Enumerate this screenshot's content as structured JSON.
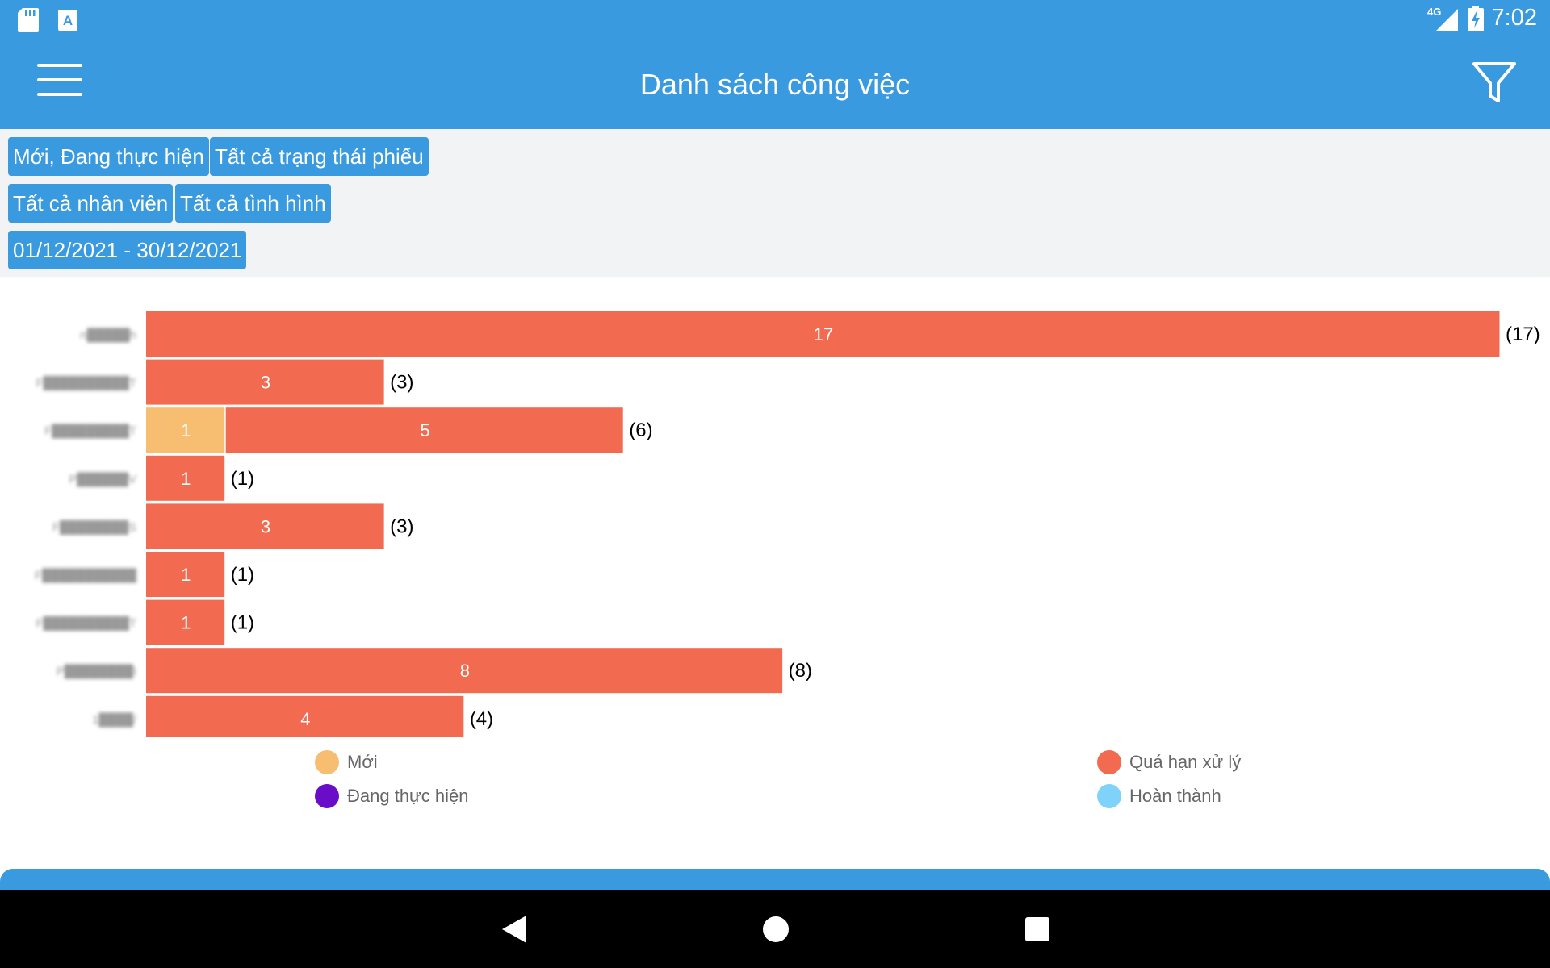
{
  "status_bar": {
    "time": "7:02",
    "network": "4G",
    "icons": [
      "sd-card-icon",
      "keyboard-a-icon",
      "signal-icon",
      "battery-charging-icon"
    ]
  },
  "app_bar": {
    "title": "Danh sách công việc",
    "menu_icon": "hamburger-menu-icon",
    "filter_icon": "filter-funnel-icon"
  },
  "filters": {
    "chips": [
      "Mới, Đang thực hiện",
      "Tất cả trạng thái phiếu",
      "Tất cả nhân viên",
      "Tất cả tình hình",
      "01/12/2021 - 30/12/2021"
    ]
  },
  "chart_data": {
    "type": "bar",
    "orientation": "horizontal",
    "stacked": true,
    "categories": [
      "n█████h",
      "F██████████T",
      "F█████████T",
      "P██████V",
      "F████████S",
      "F███████████",
      "F██████████T",
      "P████████I",
      "1████/"
    ],
    "series": [
      {
        "name": "Mới",
        "color": "#F7BE71",
        "values": [
          0,
          0,
          1,
          0,
          0,
          0,
          0,
          0,
          0
        ]
      },
      {
        "name": "Quá hạn xử lý",
        "color": "#F26A50",
        "values": [
          17,
          3,
          5,
          1,
          3,
          1,
          1,
          8,
          4
        ]
      },
      {
        "name": "Đang thực hiện",
        "color": "#6A0DC8",
        "values": [
          0,
          0,
          0,
          0,
          0,
          0,
          0,
          0,
          0
        ]
      },
      {
        "name": "Hoàn thành",
        "color": "#7FD3FA",
        "values": [
          0,
          0,
          0,
          0,
          0,
          0,
          0,
          0,
          0
        ]
      }
    ],
    "totals": [
      "(17)",
      "(3)",
      "(6)",
      "(1)",
      "(3)",
      "(1)",
      "(1)",
      "(8)",
      "(4)"
    ],
    "xlim": [
      0,
      17
    ],
    "grid": false,
    "legend_position": "bottom"
  },
  "legend": {
    "items": [
      {
        "label": "Mới",
        "color": "#F7BE71"
      },
      {
        "label": "Quá hạn xử lý",
        "color": "#F26A50"
      },
      {
        "label": "Đang thực hiện",
        "color": "#6A0DC8"
      },
      {
        "label": "Hoàn thành",
        "color": "#7FD3FA"
      }
    ]
  },
  "nav": {
    "icons": [
      "back-icon",
      "home-icon",
      "recents-icon"
    ]
  }
}
